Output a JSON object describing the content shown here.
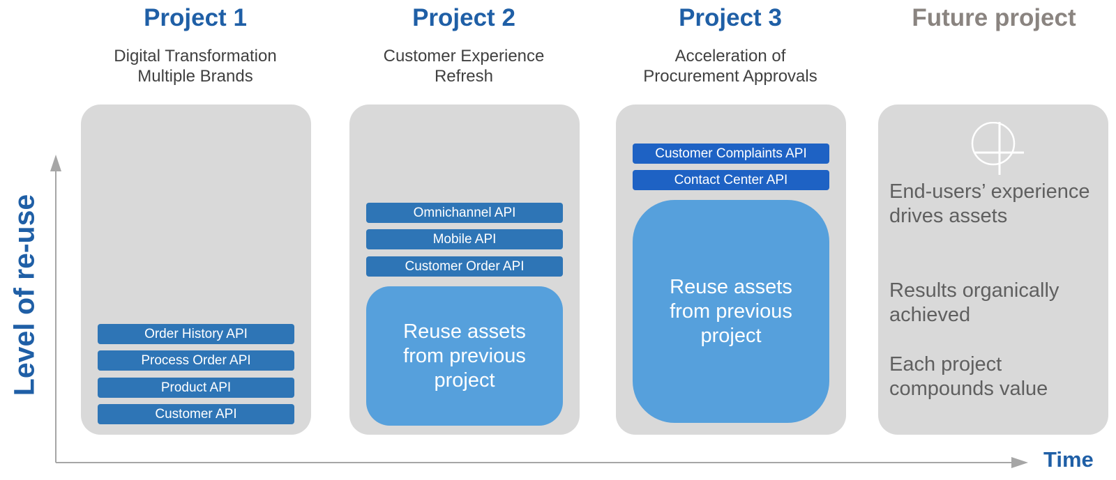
{
  "axes": {
    "y_label": "Level of re-use",
    "x_label": "Time",
    "color": "#a6a6a6"
  },
  "projects": [
    {
      "title": "Project 1",
      "subtitle_line1": "Digital Transformation",
      "subtitle_line2": "Multiple Brands",
      "apis": [
        "Order History API",
        "Process Order API",
        "Product API",
        "Customer API"
      ]
    },
    {
      "title": "Project 2",
      "subtitle_line1": "Customer Experience",
      "subtitle_line2": "Refresh",
      "apis": [
        "Omnichannel  API",
        "Mobile API",
        "Customer Order API"
      ],
      "reuse_text": "Reuse assets\nfrom previous\nproject"
    },
    {
      "title": "Project 3",
      "subtitle_line1": "Acceleration of",
      "subtitle_line2": "Procurement Approvals",
      "apis": [
        "Customer Complaints  API",
        "Contact Center API"
      ],
      "reuse_text": "Reuse assets\nfrom previous\nproject"
    },
    {
      "title": "Future project",
      "icon": "circle-plus-icon",
      "points": [
        "End-users’ experience drives assets",
        "Results organically achieved",
        "Each project compounds value"
      ]
    }
  ],
  "colors": {
    "title_blue": "#1f5fa6",
    "future_title": "#8a8480",
    "panel": "#d9d9d9",
    "api_blue": "#2e75b6",
    "api_blue_dark": "#1e62c4",
    "reuse_blue": "#56a0dc"
  }
}
